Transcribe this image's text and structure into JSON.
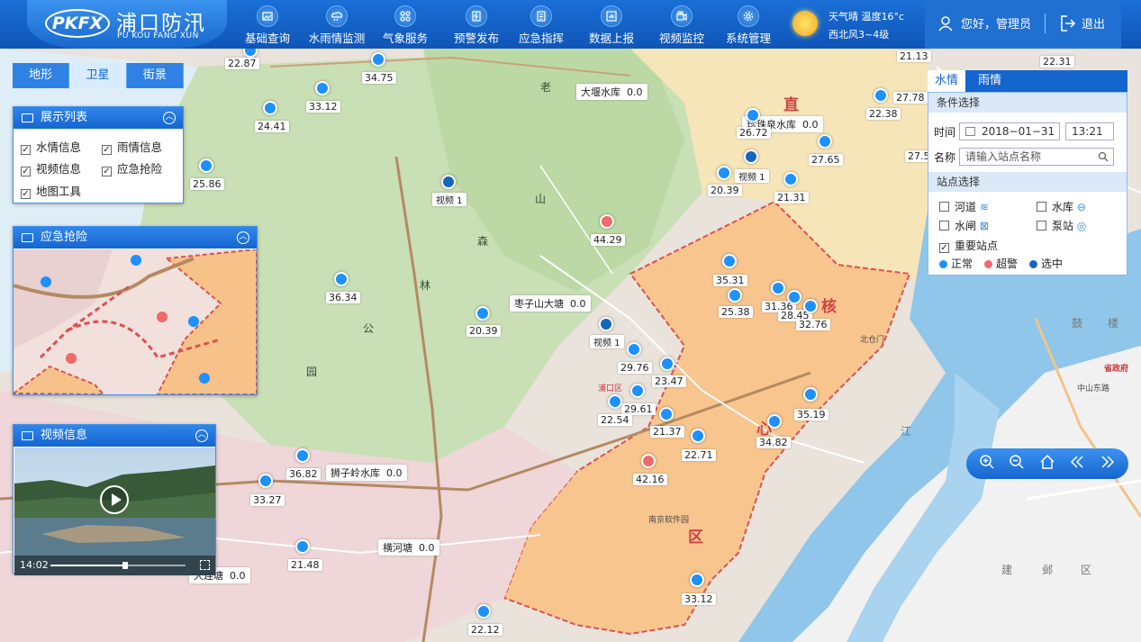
{
  "brand": {
    "badge": "PKFX",
    "title": "浦口防汛",
    "subtitle": "PU KOU FANG XUN"
  },
  "nav": [
    {
      "label": "基础查询",
      "icon": "image-icon"
    },
    {
      "label": "水雨情监测",
      "icon": "cloud-rain-icon"
    },
    {
      "label": "气象服务",
      "icon": "grid-icon"
    },
    {
      "label": "预警发布",
      "icon": "alert-icon"
    },
    {
      "label": "应急指挥",
      "icon": "document-icon"
    },
    {
      "label": "数据上报",
      "icon": "report-icon"
    },
    {
      "label": "视频监控",
      "icon": "camera-icon"
    },
    {
      "label": "系统管理",
      "icon": "gear-icon"
    }
  ],
  "weather": {
    "line1": "天气晴  温度16°c",
    "line2": "西北风3~4级",
    "icon": "sun-icon"
  },
  "user": {
    "greeting": "您好，管理员",
    "logout": "退出"
  },
  "map_type": {
    "options": [
      "地形",
      "卫星",
      "街景"
    ],
    "selected": "卫星"
  },
  "display_list": {
    "title": "展示列表",
    "items": [
      {
        "label": "水情信息",
        "checked": true
      },
      {
        "label": "雨情信息",
        "checked": true
      },
      {
        "label": "视频信息",
        "checked": true
      },
      {
        "label": "应急抢险",
        "checked": true
      },
      {
        "label": "地图工具",
        "checked": true
      }
    ]
  },
  "emergency": {
    "title": "应急抢险"
  },
  "video": {
    "title": "视频信息",
    "time": "14:02",
    "progress": 0.55
  },
  "right_panel": {
    "tabs": [
      "水情",
      "雨情"
    ],
    "selected_tab": "水情",
    "condition_title": "条件选择",
    "time_label": "时间",
    "date_value": "2018−01−31",
    "time_value": "13:21",
    "name_label": "名称",
    "name_placeholder": "请输入站点名称",
    "station_title": "站点选择",
    "stations": [
      {
        "label": "河道",
        "checked": false
      },
      {
        "label": "水库",
        "checked": false
      },
      {
        "label": "水闸",
        "checked": false
      },
      {
        "label": "泵站",
        "checked": false
      },
      {
        "label": "重要站点",
        "checked": true
      }
    ],
    "legend": [
      {
        "label": "正常",
        "color": "#1e90ff"
      },
      {
        "label": "超警",
        "color": "#f06a6a"
      },
      {
        "label": "选中",
        "color": "#1565c0"
      }
    ]
  },
  "map_tools": [
    "zoom-in-icon",
    "zoom-out-icon",
    "home-icon",
    "prev-icon",
    "next-icon"
  ],
  "readings": [
    "22.87",
    "34.75",
    "33.12",
    "24.41",
    "25.86",
    "26.72",
    "20.39",
    "21.31",
    "27.65",
    "27.5",
    "21.13",
    "22.31",
    "27.78",
    "22.38",
    "44.29",
    "36.34",
    "20.39",
    "35.31",
    "25.38",
    "31.36",
    "28.45",
    "32.76",
    "29.76",
    "23.47",
    "29.61",
    "22.54",
    "21.37",
    "35.19",
    "34.82",
    "22.71",
    "42.16",
    "36.82",
    "33.27",
    "21.48",
    "33.12",
    "22.12"
  ],
  "reservoirs": [
    {
      "name": "大堰水库",
      "value": "0.0"
    },
    {
      "name": "珍珠泉水库",
      "value": "0.0"
    },
    {
      "name": "枣子山大塘",
      "value": "0.0"
    },
    {
      "name": "狮子岭水库",
      "value": "0.0"
    },
    {
      "name": "横河塘",
      "value": "0.0"
    },
    {
      "name": "大连塘",
      "value": "0.0"
    }
  ],
  "video_tags": [
    "视频 1",
    "视频 1",
    "视频 1"
  ],
  "place_labels": {
    "forest": [
      "老",
      "山",
      "森",
      "林",
      "公",
      "园"
    ],
    "core": [
      "直",
      "核",
      "心",
      "区"
    ],
    "other": [
      "南京软件园",
      "建",
      "邺",
      "区",
      "鼓",
      "楼",
      "省政府",
      "江",
      "浦口区",
      "北仓门",
      "中山东路"
    ]
  }
}
